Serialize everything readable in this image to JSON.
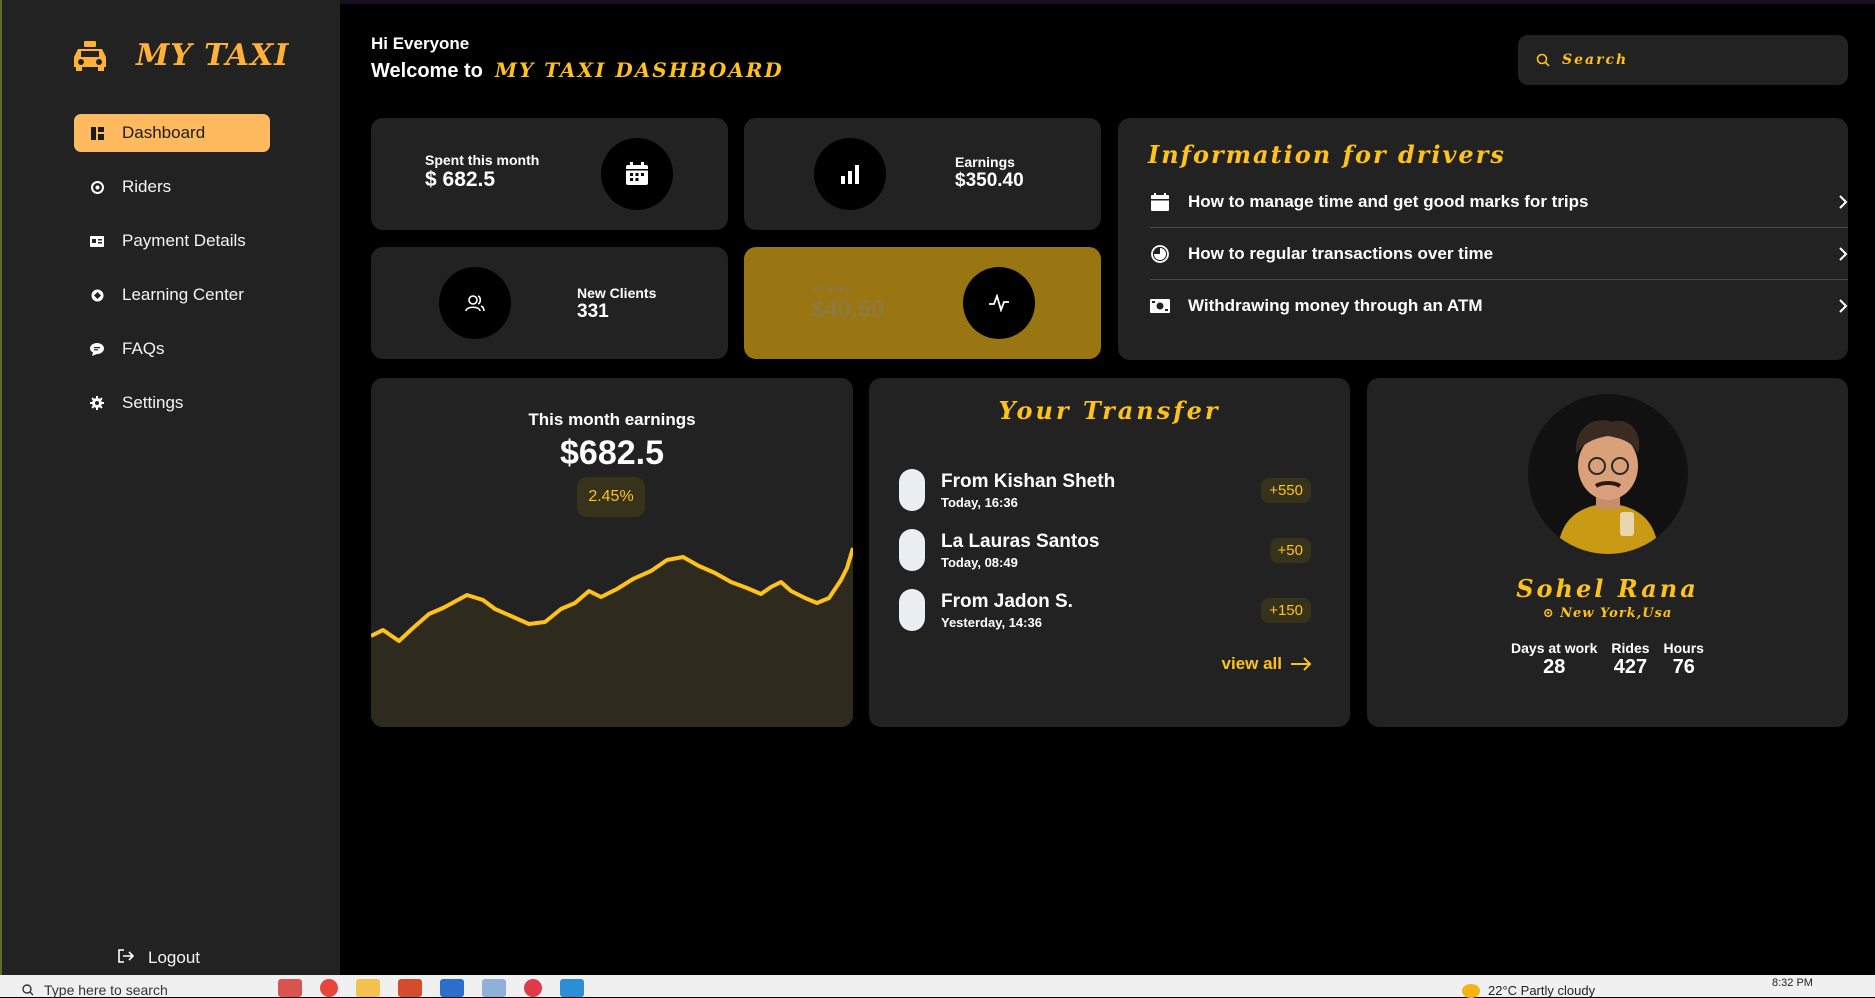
{
  "brand": {
    "name": "MY TAXI",
    "icon": "taxi-icon"
  },
  "nav": [
    {
      "label": "Dashboard",
      "icon": "dashboard-icon",
      "active": true
    },
    {
      "label": "Riders",
      "icon": "riders-icon"
    },
    {
      "label": "Payment Details",
      "icon": "payment-icon"
    },
    {
      "label": "Learning Center",
      "icon": "learning-icon"
    },
    {
      "label": "FAQs",
      "icon": "chat-icon"
    },
    {
      "label": "Settings",
      "icon": "gear-icon"
    }
  ],
  "logout": "Logout",
  "greeting": {
    "hi": "Hi Everyone",
    "welcome": "Welcome to",
    "brand": "MY TAXI DASHBOARD"
  },
  "search": {
    "placeholder": "Search"
  },
  "stats": {
    "spent": {
      "label": "Spent this month",
      "value": "$ 682.5"
    },
    "earnings": {
      "label": "Earnings",
      "value": "$350.40"
    },
    "clients": {
      "label": "New Clients",
      "value": "331"
    },
    "activity": {
      "label": "Activity",
      "value": "$40.50"
    }
  },
  "info": {
    "title": "Information for drivers",
    "items": [
      {
        "text": "How to manage time and get good marks for trips",
        "icon": "calendar-icon"
      },
      {
        "text": "How to regular transactions over time",
        "icon": "clock-icon"
      },
      {
        "text": "Withdrawing money through an ATM",
        "icon": "money-icon"
      }
    ]
  },
  "month_earnings": {
    "title": "This month earnings",
    "value": "$682.5",
    "change": "2.45%"
  },
  "transfer": {
    "title": "Your Transfer",
    "items": [
      {
        "name": "From Kishan Sheth",
        "time": "Today, 16:36",
        "amount": "+550"
      },
      {
        "name": "La Lauras Santos",
        "time": "Today, 08:49",
        "amount": "+50"
      },
      {
        "name": "From Jadon S.",
        "time": "Yesterday, 14:36",
        "amount": "+150"
      }
    ],
    "view_all": "view all"
  },
  "profile": {
    "name": "Sohel Rana",
    "location": "New York,Usa",
    "stats": [
      {
        "label": "Days at work",
        "value": "28"
      },
      {
        "label": "Rides",
        "value": "427"
      },
      {
        "label": "Hours",
        "value": "76"
      }
    ]
  },
  "taskbar": {
    "search": "Type here to search",
    "weather": "22°C  Partly cloudy",
    "time": "8:32 PM"
  },
  "colors": {
    "accent": "#ffc21a",
    "nav_active": "#ffba5f",
    "card": "#222222",
    "activity": "#9a7612"
  }
}
